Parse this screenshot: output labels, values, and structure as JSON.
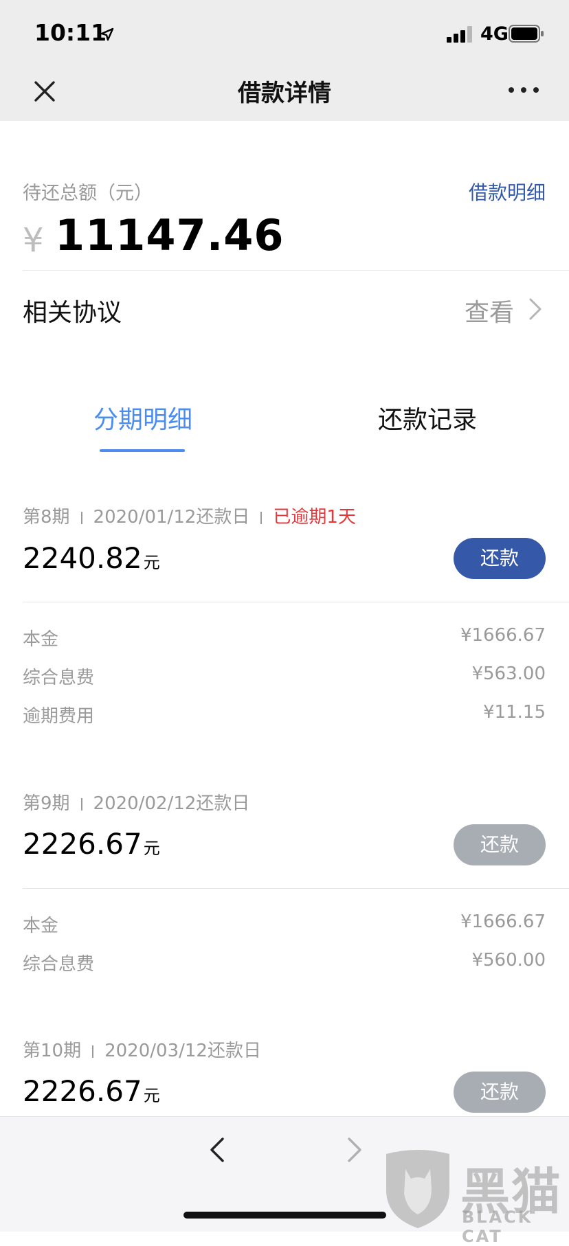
{
  "status_bar": {
    "time": "10:11",
    "network": "4G"
  },
  "nav": {
    "title": "借款详情"
  },
  "summary": {
    "label": "待还总额（元）",
    "detail_link": "借款明细",
    "currency": "¥",
    "amount": "11147.46"
  },
  "agreement": {
    "label": "相关协议",
    "action": "查看"
  },
  "tabs": [
    {
      "label": "分期明细",
      "active": true
    },
    {
      "label": "还款记录",
      "active": false
    }
  ],
  "installments": [
    {
      "period": "第8期",
      "due": "2020/01/12还款日",
      "overdue": "已逾期1天",
      "amount": "2240.82",
      "unit": "元",
      "button": "还款",
      "rows": [
        {
          "label": "本金",
          "value": "¥1666.67"
        },
        {
          "label": "综合息费",
          "value": "¥563.00"
        },
        {
          "label": "逾期费用",
          "value": "¥11.15"
        }
      ]
    },
    {
      "period": "第9期",
      "due": "2020/02/12还款日",
      "amount": "2226.67",
      "unit": "元",
      "button": "还款",
      "rows": [
        {
          "label": "本金",
          "value": "¥1666.67"
        },
        {
          "label": "综合息费",
          "value": "¥560.00"
        }
      ]
    },
    {
      "period": "第10期",
      "due": "2020/03/12还款日",
      "amount": "2226.67",
      "unit": "元",
      "button": "还款"
    }
  ],
  "watermark": {
    "cn": "黑猫",
    "en": "BLACK CAT"
  },
  "colors": {
    "accent_blue": "#4a8cf0",
    "button_primary": "#3558a8",
    "button_disabled": "#a8acb3",
    "overdue_red": "#e4373a",
    "link_blue": "#3559a9"
  }
}
